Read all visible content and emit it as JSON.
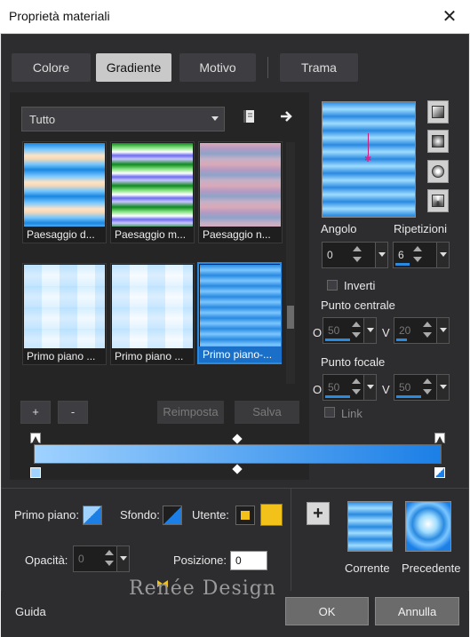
{
  "window": {
    "title": "Proprietà materiali",
    "close_glyph": "✕"
  },
  "tabs": [
    {
      "label": "Colore"
    },
    {
      "label": "Gradiente"
    },
    {
      "label": "Motivo"
    },
    {
      "label": "Trama"
    }
  ],
  "gradient_list": {
    "filter_value": "Tutto",
    "items": [
      {
        "label": "Paesaggio d..."
      },
      {
        "label": "Paesaggio m..."
      },
      {
        "label": "Paesaggio n..."
      },
      {
        "label": "Primo piano ..."
      },
      {
        "label": "Primo piano ..."
      },
      {
        "label": "Primo piano-..."
      }
    ],
    "add_label": "+",
    "remove_label": "-",
    "reset_label": "Reimposta",
    "save_label": "Salva"
  },
  "settings": {
    "angle_label": "Angolo",
    "angle_value": "0",
    "repeats_label": "Ripetizioni",
    "repeats_value": "6",
    "invert_label": "Inverti",
    "center_label": "Punto centrale",
    "center_h_label": "O",
    "center_h_value": "50",
    "center_v_label": "V",
    "center_v_value": "20",
    "focal_label": "Punto focale",
    "focal_h_label": "O",
    "focal_h_value": "50",
    "focal_v_label": "V",
    "focal_v_value": "50",
    "link_label": "Link"
  },
  "lower": {
    "foreground_label": "Primo piano:",
    "background_label": "Sfondo:",
    "user_label": "Utente:",
    "opacity_label": "Opacità:",
    "opacity_value": "0",
    "position_label": "Posizione:",
    "position_value": "0",
    "add_label": "+",
    "current_label": "Corrente",
    "previous_label": "Precedente"
  },
  "footer": {
    "help_label": "Guida",
    "ok_label": "OK",
    "cancel_label": "Annulla",
    "logo_text": "Renée Design"
  },
  "colors": {
    "accent": "#2a8ae0",
    "user_color": "#f2c21a",
    "gradient_start": "#9fd2ff",
    "gradient_end": "#1b7fe6"
  }
}
